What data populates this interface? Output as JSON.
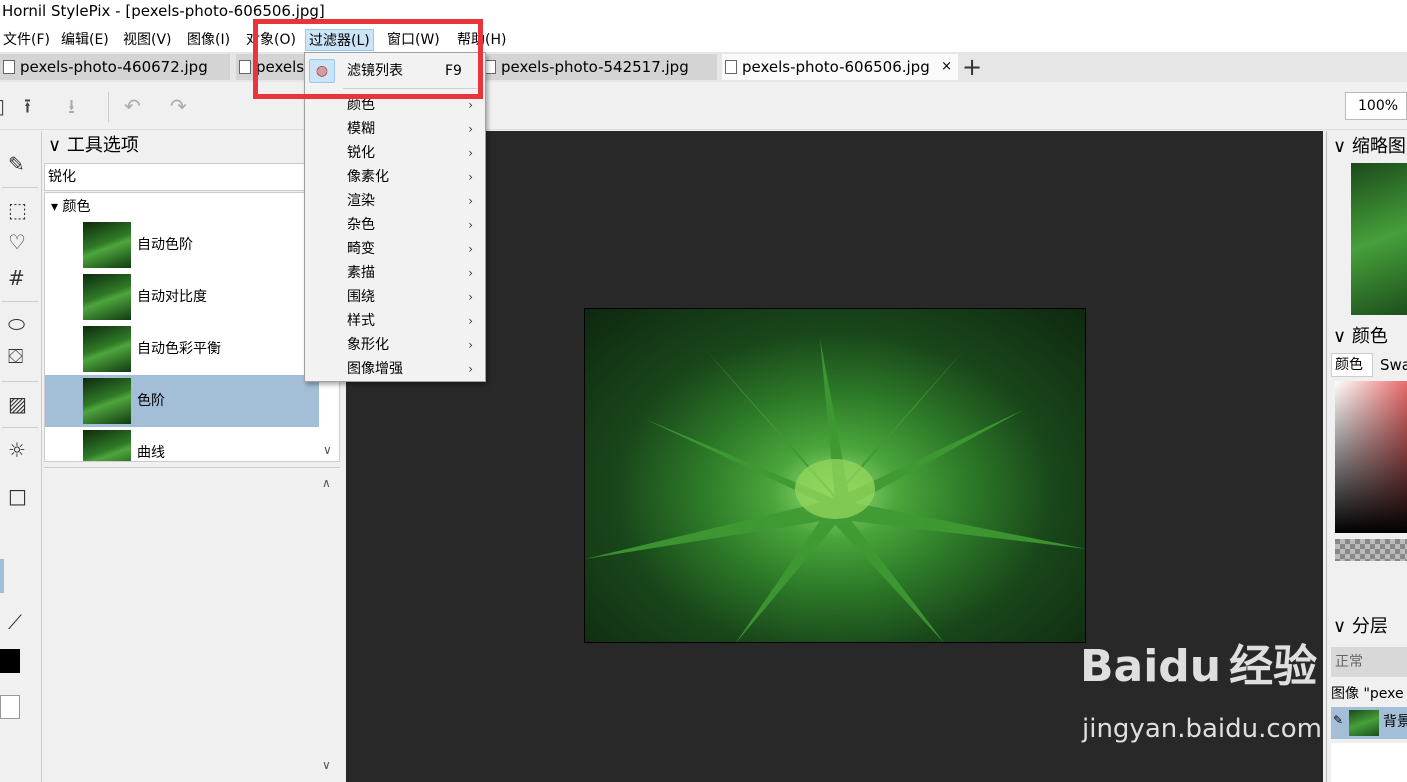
{
  "window": {
    "title": "Hornil StylePix - [pexels-photo-606506.jpg]"
  },
  "menu": {
    "items": [
      {
        "label": "文件(F)"
      },
      {
        "label": "编辑(E)"
      },
      {
        "label": "视图(V)"
      },
      {
        "label": "图像(I)"
      },
      {
        "label": "对象(O)"
      },
      {
        "label": "过滤器(L)"
      },
      {
        "label": "窗口(W)"
      },
      {
        "label": "帮助(H)"
      }
    ]
  },
  "tabs": [
    {
      "label": "pexels-photo-460672.jpg"
    },
    {
      "label": "pexels"
    },
    {
      "label": "pexels-photo-542517.jpg"
    },
    {
      "label": "pexels-photo-606506.jpg",
      "close": "×"
    }
  ],
  "tab_add": "+",
  "toolbar": {
    "zoom": "100%"
  },
  "left_panel": {
    "title": "工具选项",
    "filter_value": "锐化",
    "group": "颜色",
    "items": [
      {
        "label": "自动色阶"
      },
      {
        "label": "自动对比度"
      },
      {
        "label": "自动色彩平衡"
      },
      {
        "label": "色阶",
        "selected": true
      },
      {
        "label": "曲线"
      }
    ]
  },
  "right_panel": {
    "thumbnail_title": "缩略图",
    "color_title": "颜色",
    "color_tabs": [
      "颜色",
      "Swa"
    ],
    "layers_title": "分层",
    "blend_mode": "正常",
    "image_label": "图像 \"pexe",
    "layer_name": "背景"
  },
  "dropdown": {
    "items": [
      {
        "label": "滤镜列表",
        "shortcut": "F9"
      },
      {
        "label": "颜色"
      },
      {
        "label": "模糊"
      },
      {
        "label": "锐化"
      },
      {
        "label": "像素化"
      },
      {
        "label": "渲染"
      },
      {
        "label": "杂色"
      },
      {
        "label": "畸变"
      },
      {
        "label": "素描"
      },
      {
        "label": "围绕"
      },
      {
        "label": "样式"
      },
      {
        "label": "象形化"
      },
      {
        "label": "图像增强"
      }
    ]
  },
  "watermark": {
    "brand": "Baidu",
    "brand_cn": "经验",
    "url": "jingyan.baidu.com"
  },
  "colors": {
    "highlight": "#e8343b",
    "selection": "#a3bed7",
    "canvas_bg": "#282828"
  }
}
